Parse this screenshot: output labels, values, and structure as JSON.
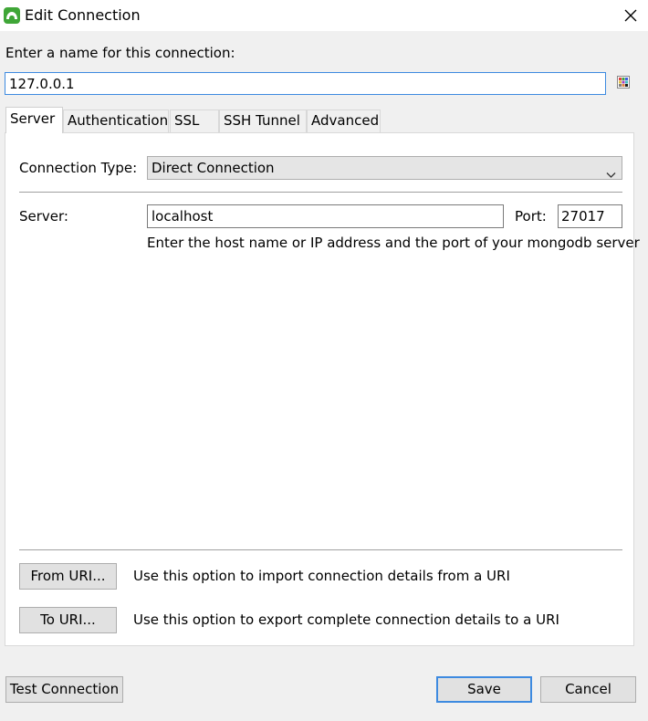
{
  "window": {
    "title": "Edit Connection",
    "app_icon": "mongo-leaf-icon",
    "close_icon": "close-icon"
  },
  "connection_name": {
    "label": "Enter a name for this connection:",
    "value": "127.0.0.1",
    "color_picker_icon": "color-picker-icon"
  },
  "tabs": [
    {
      "label": "Server",
      "active": true
    },
    {
      "label": "Authentication",
      "active": false
    },
    {
      "label": "SSL",
      "active": false
    },
    {
      "label": "SSH Tunnel",
      "active": false
    },
    {
      "label": "Advanced",
      "active": false
    }
  ],
  "server_tab": {
    "connection_type_label": "Connection Type:",
    "connection_type_value": "Direct Connection",
    "server_label": "Server:",
    "server_value": "localhost",
    "port_label": "Port:",
    "port_value": "27017",
    "hint": "Enter the host name or IP address and the port of your mongodb server",
    "from_uri_button": "From URI...",
    "from_uri_description": "Use this option to import connection details from a URI",
    "to_uri_button": "To URI...",
    "to_uri_description": "Use this option to export complete connection details to a URI"
  },
  "footer": {
    "test_button": "Test Connection",
    "save_button": "Save",
    "cancel_button": "Cancel"
  },
  "colors": {
    "accent": "#3d8ae0",
    "app_icon": "#3fa637",
    "dialog_background": "#f0f0f0"
  }
}
